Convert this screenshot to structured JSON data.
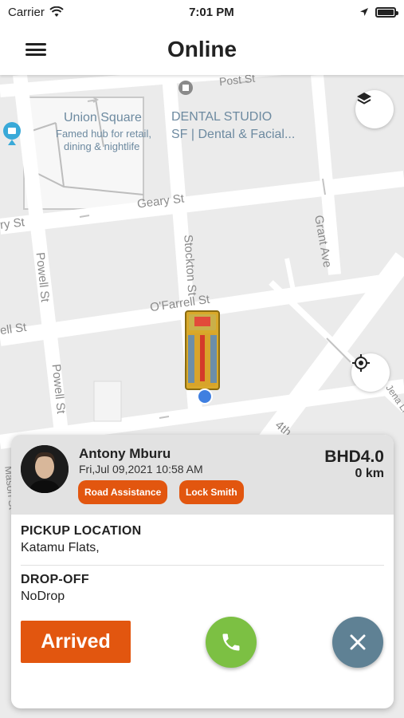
{
  "status_bar": {
    "carrier": "Carrier",
    "time": "7:01 PM"
  },
  "header": {
    "title": "Online"
  },
  "map": {
    "labels": {
      "union_square": "Union Square",
      "union_square_desc_1": "Famed hub for retail,",
      "union_square_desc_2": "dining & nightlife",
      "dental_1": "DENTAL STUDIO",
      "dental_2": "SF | Dental & Facial...",
      "post_st": "Post St",
      "geary_st": "Geary St",
      "geary_st_left": "ry St",
      "grant_ave": "Grant Ave",
      "stockton_st": "Stockton St",
      "powell_st_1": "Powell St",
      "powell_st_2": "Powell St",
      "ofarrell_st": "O'Farrell St",
      "ofarrell_left": "ell St",
      "jena_ln": "Jena Ln",
      "fourth": "4th",
      "mason_st": "Mason St"
    }
  },
  "ride": {
    "customer_name": "Antony Mburu",
    "datetime": "Fri,Jul 09,2021 10:58 AM",
    "tags": [
      "Road Assistance",
      "Lock Smith"
    ],
    "price": "BHD4.0",
    "distance": "0 km",
    "pickup_label": "PICKUP LOCATION",
    "pickup_value": "Katamu Flats,",
    "dropoff_label": "DROP-OFF",
    "dropoff_value": "NoDrop",
    "arrived_label": "Arrived"
  },
  "colors": {
    "accent": "#e2560f",
    "call": "#7cc043",
    "close": "#5f8194"
  }
}
